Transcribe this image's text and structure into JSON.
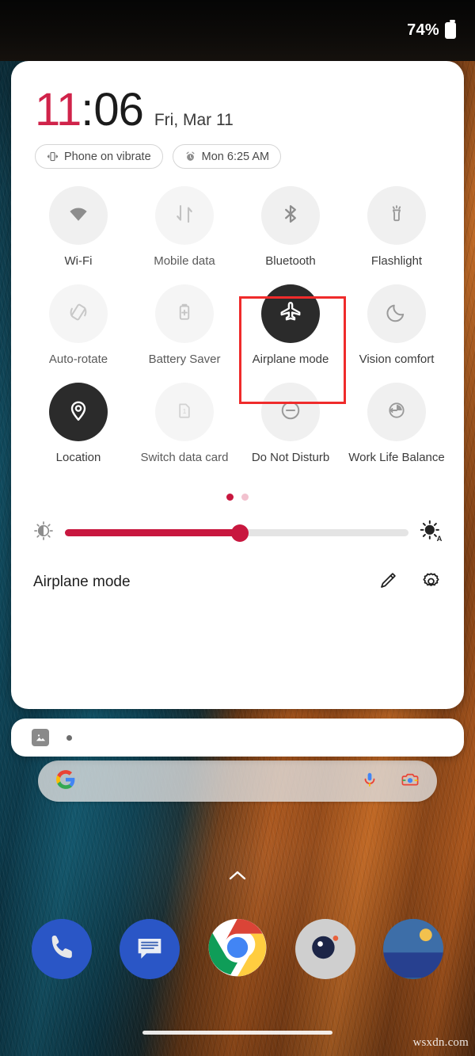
{
  "status_bar": {
    "battery_percent": "74%",
    "battery_icon": "battery-full-icon"
  },
  "quick_settings": {
    "clock": {
      "hours": "11",
      "separator": ":",
      "minutes": "06",
      "date": "Fri, Mar 11",
      "hours_color": "#d0234a"
    },
    "chips": [
      {
        "icon": "vibrate-icon",
        "label": "Phone on vibrate"
      },
      {
        "icon": "alarm-clock-icon",
        "label": "Mon 6:25 AM"
      }
    ],
    "tiles": [
      {
        "label": "Wi-Fi",
        "icon": "wifi-icon",
        "state": "off"
      },
      {
        "label": "Mobile data",
        "icon": "mobile-data-icon",
        "state": "disabled"
      },
      {
        "label": "Bluetooth",
        "icon": "bluetooth-icon",
        "state": "off"
      },
      {
        "label": "Flashlight",
        "icon": "flashlight-icon",
        "state": "off"
      },
      {
        "label": "Auto-rotate",
        "icon": "auto-rotate-icon",
        "state": "disabled"
      },
      {
        "label": "Battery Saver",
        "icon": "battery-saver-icon",
        "state": "disabled"
      },
      {
        "label": "Airplane mode",
        "icon": "airplane-icon",
        "state": "on"
      },
      {
        "label": "Vision comfort",
        "icon": "moon-icon",
        "state": "off"
      },
      {
        "label": "Location",
        "icon": "location-pin-icon",
        "state": "on"
      },
      {
        "label": "Switch data card",
        "icon": "sim-card-icon",
        "state": "disabled"
      },
      {
        "label": "Do Not Disturb",
        "icon": "do-not-disturb-icon",
        "state": "off"
      },
      {
        "label": "Work Life Balance",
        "icon": "work-life-balance-icon",
        "state": "off"
      }
    ],
    "highlight": {
      "target_label": "Airplane mode",
      "color": "#ef2b2b"
    },
    "page_dots": {
      "count": 2,
      "active_index": 0,
      "active_color": "#c8173f",
      "inactive_color": "#f2c2cf"
    },
    "brightness": {
      "low_icon": "brightness-low-icon",
      "auto_icon": "brightness-auto-icon",
      "value_percent": 51,
      "fill_color": "#c8173f"
    },
    "footer": {
      "title": "Airplane mode",
      "edit_icon": "pencil-icon",
      "settings_icon": "gear-icon"
    }
  },
  "notification_card": {
    "icon": "image-thumbnail-icon",
    "badge": "dot"
  },
  "search_bar": {
    "logo_icon": "google-g-icon",
    "mic_icon": "microphone-icon",
    "lens_icon": "google-lens-icon",
    "query": ""
  },
  "home": {
    "drawer_chevron_icon": "chevron-up-icon",
    "dock": [
      {
        "name": "Phone",
        "icon": "phone-icon"
      },
      {
        "name": "Messages",
        "icon": "messages-icon"
      },
      {
        "name": "Chrome",
        "icon": "chrome-icon"
      },
      {
        "name": "Camera",
        "icon": "camera-icon"
      },
      {
        "name": "Gallery",
        "icon": "gallery-icon"
      }
    ],
    "nav_pill_icon": "gesture-nav-pill"
  },
  "watermark": {
    "text": "wsxdn.com"
  }
}
